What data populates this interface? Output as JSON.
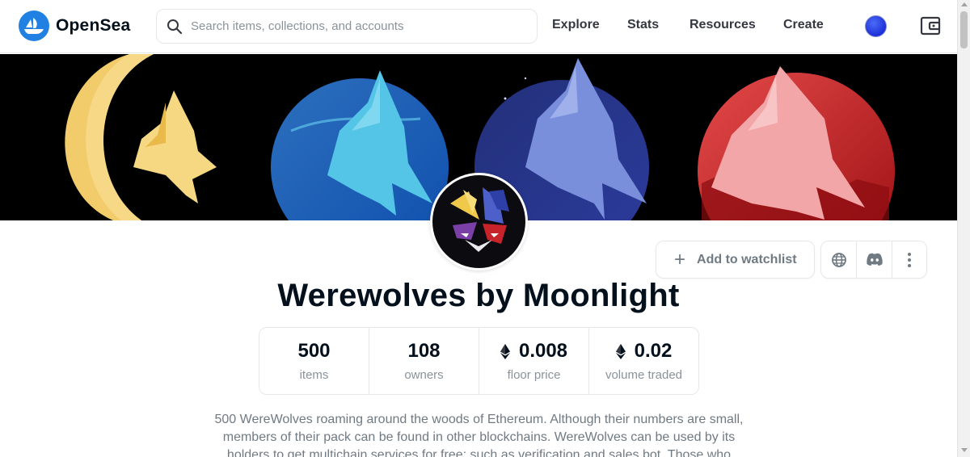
{
  "header": {
    "brand": "OpenSea",
    "search_placeholder": "Search items, collections, and accounts",
    "nav": {
      "explore": "Explore",
      "stats": "Stats",
      "resources": "Resources",
      "create": "Create"
    },
    "icons": [
      "opensea-logo-icon",
      "search-icon",
      "profile-avatar",
      "wallet-icon"
    ]
  },
  "banner": {
    "panel_colors": [
      "#f6d57a",
      "#3bb6e6",
      "#6a7fd2",
      "#ef7f86"
    ]
  },
  "collection": {
    "name": "Werewolves by Moonlight",
    "watchlist_label": "Add to watchlist",
    "action_icons": [
      "globe-icon",
      "discord-icon",
      "more-vertical-icon"
    ],
    "stats": [
      {
        "value": "500",
        "label": "items",
        "eth": false
      },
      {
        "value": "108",
        "label": "owners",
        "eth": false
      },
      {
        "value": "0.008",
        "label": "floor price",
        "eth": true
      },
      {
        "value": "0.02",
        "label": "volume traded",
        "eth": true
      }
    ],
    "description_lines": [
      "500 WereWolves roaming around the woods of Ethereum. Although their numbers are small,",
      "members of their pack can be found in other blockchains. WereWolves can be used by its",
      "holders to get multichain services for free; such as verification and sales bot. Those who"
    ]
  },
  "colors": {
    "brand_blue": "#2081e2",
    "text_primary": "#04111d",
    "text_secondary": "#707a83",
    "border": "#e5e8eb"
  }
}
